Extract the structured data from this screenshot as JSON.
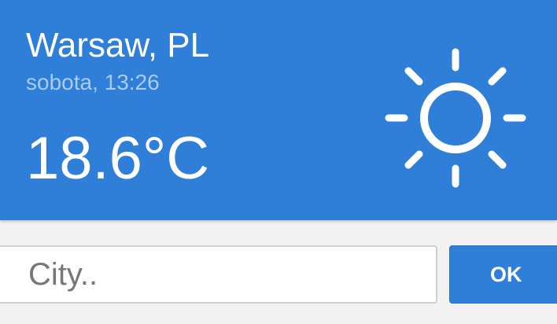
{
  "weather": {
    "location": "Warsaw, PL",
    "datetime": "sobota, 13:26",
    "temperature": "18.6°C",
    "condition_icon": "sun-icon"
  },
  "search": {
    "placeholder": "City..",
    "value": "",
    "button_label": "OK"
  },
  "colors": {
    "card_background": "#2f7ed8",
    "secondary_text": "#a9cbf2",
    "page_background": "#f2f2f2"
  }
}
